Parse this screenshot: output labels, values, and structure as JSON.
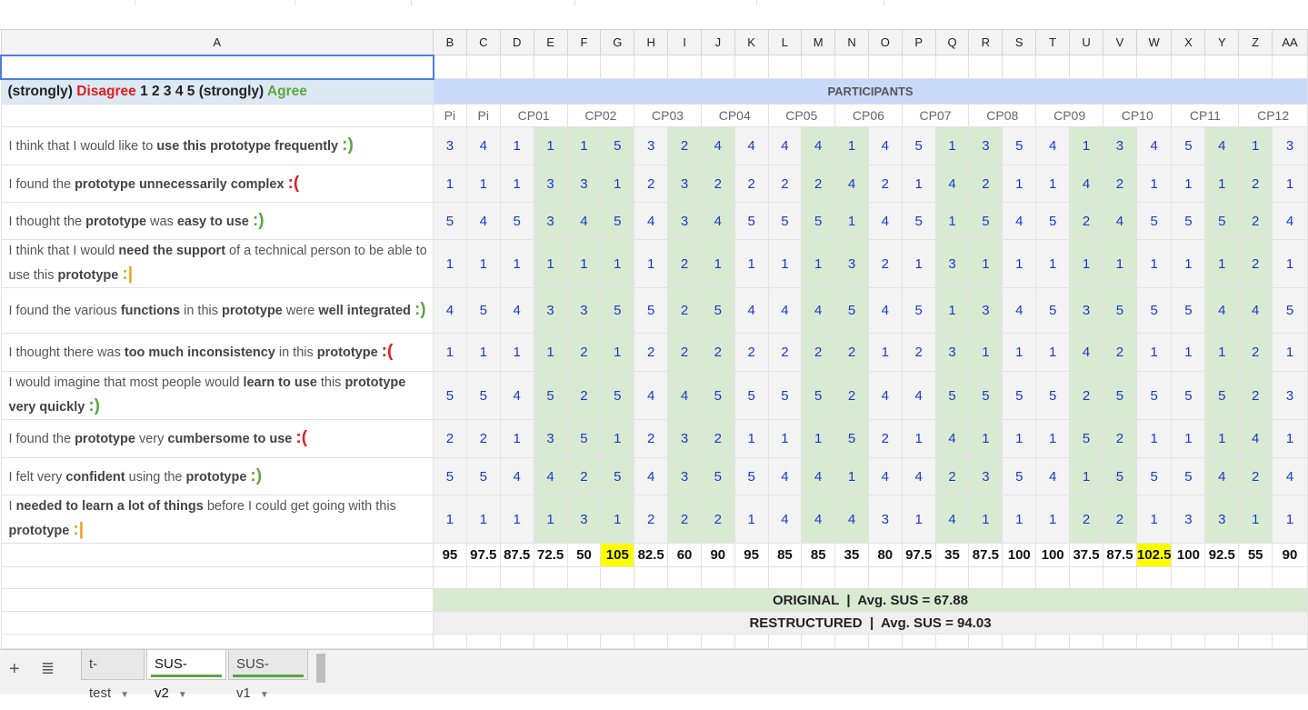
{
  "columns": [
    "A",
    "B",
    "C",
    "D",
    "E",
    "F",
    "G",
    "H",
    "I",
    "J",
    "K",
    "L",
    "M",
    "N",
    "O",
    "P",
    "Q",
    "R",
    "S",
    "T",
    "U",
    "V",
    "W",
    "X",
    "Y",
    "Z",
    "AA"
  ],
  "scale_header": {
    "prefix": "(strongly)",
    "disagree": "Disagree",
    "numbers": "1   2   3   4   5",
    "strongly2": "(strongly)",
    "agree": "Agree"
  },
  "participants_label": "PARTICIPANTS",
  "participant_ids": [
    "Pi",
    "Pi",
    "CP01",
    "",
    "CP02",
    "",
    "CP03",
    "",
    "CP04",
    "",
    "CP05",
    "",
    "CP06",
    "",
    "CP07",
    "",
    "CP08",
    "",
    "CP09",
    "",
    "CP10",
    "",
    "CP11",
    "",
    "CP12",
    ""
  ],
  "questions": [
    {
      "segments": [
        [
          "I think that I would like to ",
          0
        ],
        [
          "use this prototype frequently",
          1
        ]
      ],
      "emoticon": ":)",
      "sentiment": "pos"
    },
    {
      "segments": [
        [
          "I found the ",
          0
        ],
        [
          "prototype unnecessarily complex",
          1
        ]
      ],
      "emoticon": ":(",
      "sentiment": "neg"
    },
    {
      "segments": [
        [
          "I thought the ",
          0
        ],
        [
          "prototype",
          1
        ],
        [
          " was ",
          0
        ],
        [
          "easy to use",
          1
        ]
      ],
      "emoticon": ":)",
      "sentiment": "pos"
    },
    {
      "segments": [
        [
          "I think that I would ",
          0
        ],
        [
          "need the support",
          1
        ],
        [
          " of a technical person to be able to use this ",
          0
        ],
        [
          "prototype",
          1
        ]
      ],
      "emoticon": ":|",
      "sentiment": "neu"
    },
    {
      "segments": [
        [
          "I found the various ",
          0
        ],
        [
          "functions",
          1
        ],
        [
          " in this ",
          0
        ],
        [
          "prototype",
          1
        ],
        [
          " were ",
          0
        ],
        [
          "well integrated",
          1
        ]
      ],
      "emoticon": ":)",
      "sentiment": "pos"
    },
    {
      "segments": [
        [
          "I thought there was ",
          0
        ],
        [
          "too much inconsistency",
          1
        ],
        [
          " in this ",
          0
        ],
        [
          "prototype",
          1
        ]
      ],
      "emoticon": ":(",
      "sentiment": "neg"
    },
    {
      "segments": [
        [
          "I would imagine that most people would ",
          0
        ],
        [
          "learn to use",
          1
        ],
        [
          " this ",
          0
        ],
        [
          "prototype very quickly",
          1
        ]
      ],
      "emoticon": ":)",
      "sentiment": "pos"
    },
    {
      "segments": [
        [
          "I found the ",
          0
        ],
        [
          "prototype",
          1
        ],
        [
          " very ",
          0
        ],
        [
          "cumbersome to use",
          1
        ]
      ],
      "emoticon": ":(",
      "sentiment": "neg"
    },
    {
      "segments": [
        [
          "I felt very ",
          0
        ],
        [
          "confident",
          1
        ],
        [
          " using the ",
          0
        ],
        [
          "prototype",
          1
        ]
      ],
      "emoticon": ":)",
      "sentiment": "pos"
    },
    {
      "segments": [
        [
          "I ",
          0
        ],
        [
          "needed to learn a lot of things",
          1
        ],
        [
          " before I could get going with this ",
          0
        ],
        [
          "prototype",
          1
        ]
      ],
      "emoticon": ":|",
      "sentiment": "neu"
    }
  ],
  "responses": [
    [
      "3",
      "4",
      "1",
      "1",
      "1",
      "5",
      "3",
      "2",
      "4",
      "4",
      "4",
      "4",
      "1",
      "4",
      "5",
      "1",
      "3",
      "5",
      "4",
      "1",
      "3",
      "4",
      "5",
      "4",
      "1",
      "3"
    ],
    [
      "1",
      "1",
      "1",
      "3",
      "3",
      "1",
      "2",
      "3",
      "2",
      "2",
      "2",
      "2",
      "4",
      "2",
      "1",
      "4",
      "2",
      "1",
      "1",
      "4",
      "2",
      "1",
      "1",
      "1",
      "2",
      "1"
    ],
    [
      "5",
      "4",
      "5",
      "3",
      "4",
      "5",
      "4",
      "3",
      "4",
      "5",
      "5",
      "5",
      "1",
      "4",
      "5",
      "1",
      "5",
      "4",
      "5",
      "2",
      "4",
      "5",
      "5",
      "5",
      "2",
      "4"
    ],
    [
      "1",
      "1",
      "1",
      "1",
      "1",
      "1",
      "1",
      "2",
      "1",
      "1",
      "1",
      "1",
      "3",
      "2",
      "1",
      "3",
      "1",
      "1",
      "1",
      "1",
      "1",
      "1",
      "1",
      "1",
      "2",
      "1"
    ],
    [
      "4",
      "5",
      "4",
      "3",
      "3",
      "5",
      "5",
      "2",
      "5",
      "4",
      "4",
      "4",
      "5",
      "4",
      "5",
      "1",
      "3",
      "4",
      "5",
      "3",
      "5",
      "5",
      "5",
      "4",
      "4",
      "5"
    ],
    [
      "1",
      "1",
      "1",
      "1",
      "2",
      "1",
      "2",
      "2",
      "2",
      "2",
      "2",
      "2",
      "2",
      "1",
      "2",
      "3",
      "1",
      "1",
      "1",
      "4",
      "2",
      "1",
      "1",
      "1",
      "2",
      "1"
    ],
    [
      "5",
      "5",
      "4",
      "5",
      "2",
      "5",
      "4",
      "4",
      "5",
      "5",
      "5",
      "5",
      "2",
      "4",
      "4",
      "5",
      "5",
      "5",
      "5",
      "2",
      "5",
      "5",
      "5",
      "5",
      "2",
      "3"
    ],
    [
      "2",
      "2",
      "1",
      "3",
      "5",
      "1",
      "2",
      "3",
      "2",
      "1",
      "1",
      "1",
      "5",
      "2",
      "1",
      "4",
      "1",
      "1",
      "1",
      "5",
      "2",
      "1",
      "1",
      "1",
      "4",
      "1"
    ],
    [
      "5",
      "5",
      "4",
      "4",
      "2",
      "5",
      "4",
      "3",
      "5",
      "5",
      "4",
      "4",
      "1",
      "4",
      "4",
      "2",
      "3",
      "5",
      "4",
      "1",
      "5",
      "5",
      "5",
      "4",
      "2",
      "4"
    ],
    [
      "1",
      "1",
      "1",
      "1",
      "3",
      "1",
      "2",
      "2",
      "2",
      "1",
      "4",
      "4",
      "4",
      "3",
      "1",
      "4",
      "1",
      "1",
      "1",
      "2",
      "2",
      "1",
      "3",
      "3",
      "1",
      "1"
    ]
  ],
  "scores": [
    "95",
    "97.5",
    "87.5",
    "72.5",
    "50",
    "105",
    "82.5",
    "60",
    "90",
    "95",
    "85",
    "85",
    "35",
    "80",
    "97.5",
    "35",
    "87.5",
    "100",
    "100",
    "37.5",
    "87.5",
    "102.5",
    "100",
    "92.5",
    "55",
    "90"
  ],
  "highlighted_score_columns": [
    "G",
    "W"
  ],
  "summary": {
    "original": "ORIGINAL  |  Avg. SUS = 67.88",
    "restructured": "RESTRUCTURED  |  Avg. SUS = 94.03"
  },
  "tabs": [
    {
      "label": "t-test",
      "active": false,
      "underline": false
    },
    {
      "label": "SUS-v2",
      "active": true,
      "underline": true
    },
    {
      "label": "SUS-v1",
      "active": false,
      "underline": true
    }
  ],
  "toolbar": {
    "add_label": "+",
    "list_label": "≣"
  },
  "colors": {
    "green_cell": "#d9ead3",
    "gray_cell": "#f3f3f3",
    "value_blue": "#1a3bc8",
    "highlight_yellow": "#ffff00",
    "disagree_red": "#e01c1c",
    "agree_green": "#58a83e",
    "participants_bg": "#c9daf8",
    "neutral_orange": "#f0a020"
  }
}
